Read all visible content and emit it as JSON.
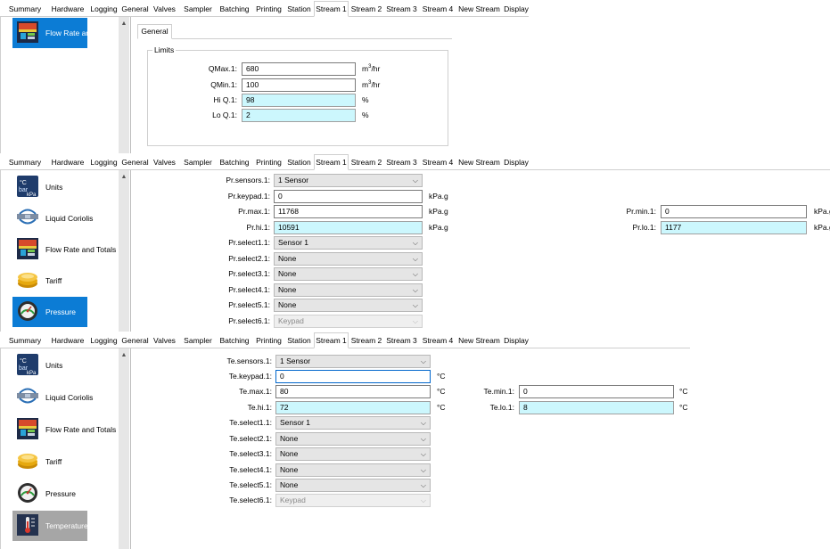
{
  "tabs": [
    "Summary",
    "Hardware",
    "Logging",
    "General",
    "Valves",
    "Sampler",
    "Batching",
    "Printing",
    "Station",
    "Stream 1",
    "Stream 2",
    "Stream 3",
    "Stream 4",
    "New Stream",
    "Display"
  ],
  "selected_tab": "Stream 1",
  "scroll_up_glyph": "▲",
  "combo_glyph": "⌵",
  "panel1": {
    "sidebar": [
      {
        "label": "Flow Rate and Totals",
        "icon": "flow-rate-totals-icon",
        "state": "active"
      }
    ],
    "inner_tab": "General",
    "group_title": "Limits",
    "fields": [
      {
        "label": "QMax.1:",
        "value": "680",
        "unit_base": "m",
        "unit_sup": "3",
        "unit_tail": "/hr",
        "style": "white"
      },
      {
        "label": "QMin.1:",
        "value": "100",
        "unit_base": "m",
        "unit_sup": "3",
        "unit_tail": "/hr",
        "style": "white"
      },
      {
        "label": "Hi Q.1:",
        "value": "98",
        "unit_base": "%",
        "unit_sup": "",
        "unit_tail": "",
        "style": "cyan"
      },
      {
        "label": "Lo Q.1:",
        "value": "2",
        "unit_base": "%",
        "unit_sup": "",
        "unit_tail": "",
        "style": "cyan"
      }
    ]
  },
  "panel2": {
    "sidebar": [
      {
        "label": "Units",
        "icon": "units-icon",
        "state": "normal"
      },
      {
        "label": "Liquid Coriolis",
        "icon": "liquid-coriolis-icon",
        "state": "normal"
      },
      {
        "label": "Flow Rate and Totals",
        "icon": "flow-rate-totals-icon",
        "state": "normal"
      },
      {
        "label": "Tariff",
        "icon": "tariff-icon",
        "state": "normal"
      },
      {
        "label": "Pressure",
        "icon": "pressure-icon",
        "state": "active"
      }
    ],
    "sensors": {
      "label": "Pr.sensors.1:",
      "value": "1 Sensor"
    },
    "keypad": {
      "label": "Pr.keypad.1:",
      "value": "0",
      "unit": "kPa.g"
    },
    "max": {
      "label": "Pr.max.1:",
      "value": "11768",
      "unit": "kPa.g"
    },
    "hi": {
      "label": "Pr.hi.1:",
      "value": "10591",
      "unit": "kPa.g"
    },
    "min": {
      "label": "Pr.min.1:",
      "value": "0",
      "unit": "kPa.g"
    },
    "lo": {
      "label": "Pr.lo.1:",
      "value": "1177",
      "unit": "kPa.g"
    },
    "selects": [
      {
        "label": "Pr.select1.1:",
        "value": "Sensor 1",
        "disabled": false
      },
      {
        "label": "Pr.select2.1:",
        "value": "None",
        "disabled": false
      },
      {
        "label": "Pr.select3.1:",
        "value": "None",
        "disabled": false
      },
      {
        "label": "Pr.select4.1:",
        "value": "None",
        "disabled": false
      },
      {
        "label": "Pr.select5.1:",
        "value": "None",
        "disabled": false
      },
      {
        "label": "Pr.select6.1:",
        "value": "Keypad",
        "disabled": true
      }
    ]
  },
  "panel3": {
    "sidebar": [
      {
        "label": "Units",
        "icon": "units-icon",
        "state": "normal"
      },
      {
        "label": "Liquid Coriolis",
        "icon": "liquid-coriolis-icon",
        "state": "normal"
      },
      {
        "label": "Flow Rate and Totals",
        "icon": "flow-rate-totals-icon",
        "state": "normal"
      },
      {
        "label": "Tariff",
        "icon": "tariff-icon",
        "state": "normal"
      },
      {
        "label": "Pressure",
        "icon": "pressure-icon",
        "state": "normal"
      },
      {
        "label": "Temperature",
        "icon": "temperature-icon",
        "state": "inactive-selected"
      }
    ],
    "sensors": {
      "label": "Te.sensors.1:",
      "value": "1 Sensor"
    },
    "keypad": {
      "label": "Te.keypad.1:",
      "value": "0",
      "unit": "°C"
    },
    "max": {
      "label": "Te.max.1:",
      "value": "80",
      "unit": "°C"
    },
    "hi": {
      "label": "Te.hi.1:",
      "value": "72",
      "unit": "°C"
    },
    "min": {
      "label": "Te.min.1:",
      "value": "0",
      "unit": "°C"
    },
    "lo": {
      "label": "Te.lo.1:",
      "value": "8",
      "unit": "°C"
    },
    "selects": [
      {
        "label": "Te.select1.1:",
        "value": "Sensor 1",
        "disabled": false
      },
      {
        "label": "Te.select2.1:",
        "value": "None",
        "disabled": false
      },
      {
        "label": "Te.select3.1:",
        "value": "None",
        "disabled": false
      },
      {
        "label": "Te.select4.1:",
        "value": "None",
        "disabled": false
      },
      {
        "label": "Te.select5.1:",
        "value": "None",
        "disabled": false
      },
      {
        "label": "Te.select6.1:",
        "value": "Keypad",
        "disabled": true
      }
    ]
  },
  "colors": {
    "accent_selected": "#0c7cd5",
    "inactive_selected": "#a6a6a6",
    "cyan_field": "#ccf7fd",
    "border": "#7a7a7a"
  }
}
